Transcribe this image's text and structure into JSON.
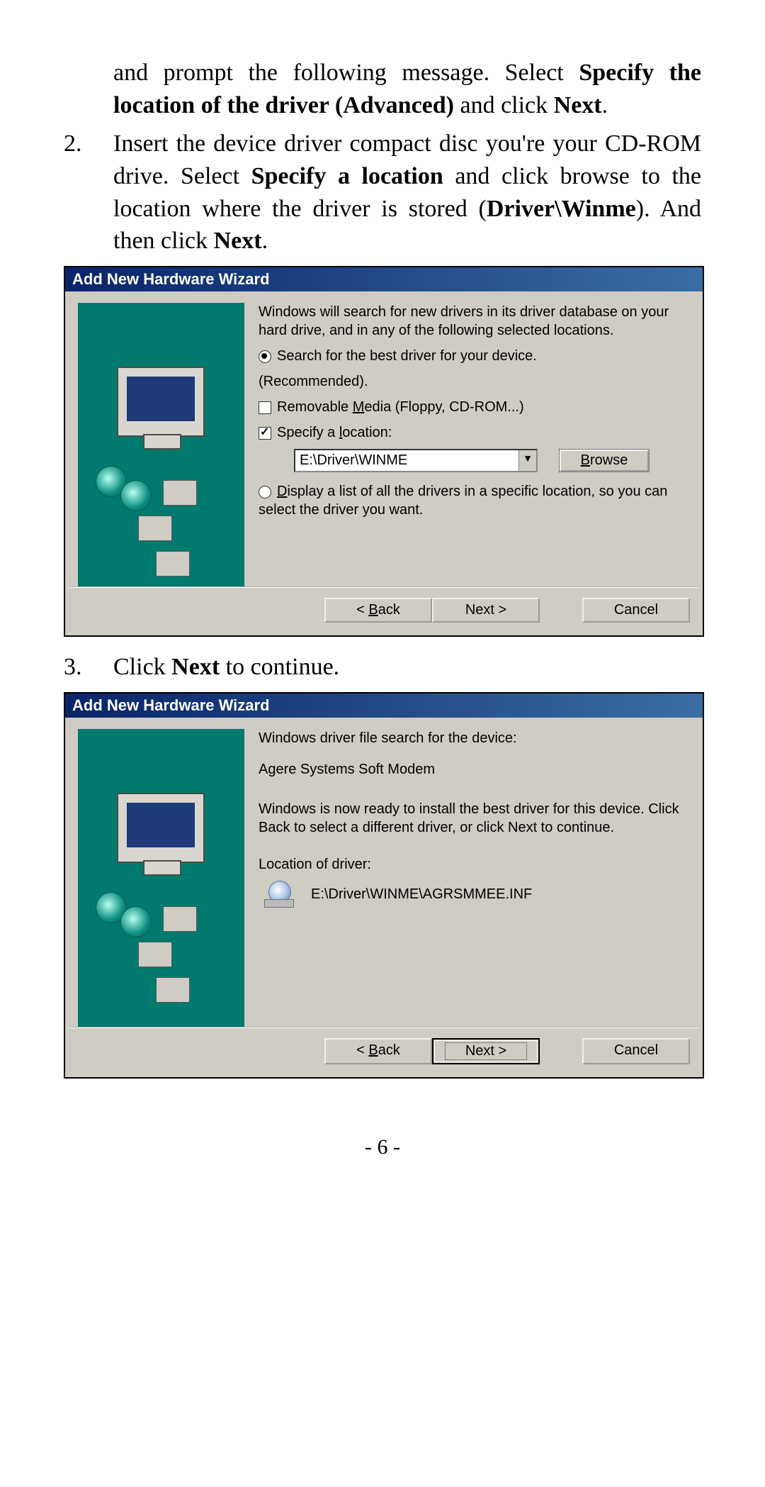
{
  "intro": {
    "line1_a": "and prompt the following message.   Select ",
    "bold1": "Specify the location of the driver (Advanced)",
    "line1_b": " and click ",
    "bold2": "Next",
    "line1_c": "."
  },
  "step2": {
    "num": "2.",
    "a": "Insert the device driver compact disc you're your CD-ROM drive.  Select ",
    "bold1": "Specify a location",
    "b": " and click browse to the location where the driver is stored (",
    "bold2": "Driver\\Winme",
    "c": ").  And then click ",
    "bold3": "Next",
    "d": "."
  },
  "wizard1": {
    "title": "Add New Hardware Wizard",
    "intro": "Windows will search for new drivers in its driver database on your hard drive, and in any of the following selected locations.",
    "opt1_a": "Search for the best driver for your device.",
    "opt1_b": "(Recommended).",
    "chk1_pre": "Removable ",
    "chk1_u": "M",
    "chk1_post": "edia (Floppy, CD-ROM...)",
    "chk2_pre": "Specify a ",
    "chk2_u": "l",
    "chk2_post": "ocation:",
    "path": "E:\\Driver\\WINME",
    "browse_u": "B",
    "browse_post": "rowse",
    "opt2_u": "D",
    "opt2": "isplay a list of all the drivers in a specific location, so you can select the driver you want.",
    "back_pre": "< ",
    "back_u": "B",
    "back_post": "ack",
    "next": "Next >",
    "cancel": "Cancel"
  },
  "step3": {
    "num": "3.",
    "a": "Click ",
    "bold": "Next",
    "b": " to continue."
  },
  "wizard2": {
    "title": "Add New Hardware Wizard",
    "line1": "Windows driver file search for the device:",
    "device": "Agere Systems Soft Modem",
    "line2": "Windows is now ready to install the best driver for this device. Click Back to select a different driver, or click Next to continue.",
    "loc_label": "Location of driver:",
    "loc_path": "E:\\Driver\\WINME\\AGRSMMEE.INF",
    "back_pre": "< ",
    "back_u": "B",
    "back_post": "ack",
    "next": "Next >",
    "cancel": "Cancel"
  },
  "page_num": "- 6 -"
}
